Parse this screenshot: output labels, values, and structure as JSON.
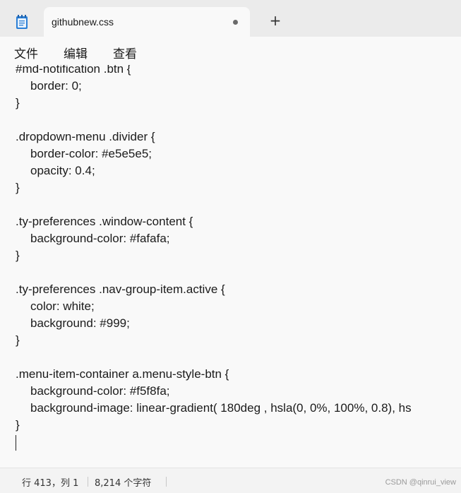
{
  "tab": {
    "title": "githubnew.css",
    "unsaved_icon": "dot-icon",
    "new_tab_label": "+"
  },
  "menu": [
    "文件",
    "编辑",
    "查看"
  ],
  "editor": {
    "lines": [
      "#md-notification .btn {",
      "border: 0;",
      "}",
      "",
      ".dropdown-menu .divider {",
      "border-color: #e5e5e5;",
      "opacity: 0.4;",
      "}",
      "",
      ".ty-preferences .window-content {",
      "background-color: #fafafa;",
      "}",
      "",
      ".ty-preferences .nav-group-item.active {",
      "color: white;",
      "background: #999;",
      "}",
      "",
      ".menu-item-container a.menu-style-btn {",
      "background-color: #f5f8fa;",
      "background-image: linear-gradient( 180deg , hsla(0, 0%, 100%, 0.8), hs",
      "}"
    ]
  },
  "status": {
    "position": "行 413，列 1",
    "char_count": "8,214 个字符"
  },
  "watermark": "CSDN @qinrui_view",
  "colors": {
    "tabbar": "#ebebeb",
    "editor_bg": "#f9f9f9",
    "text": "#1b1b1b"
  }
}
